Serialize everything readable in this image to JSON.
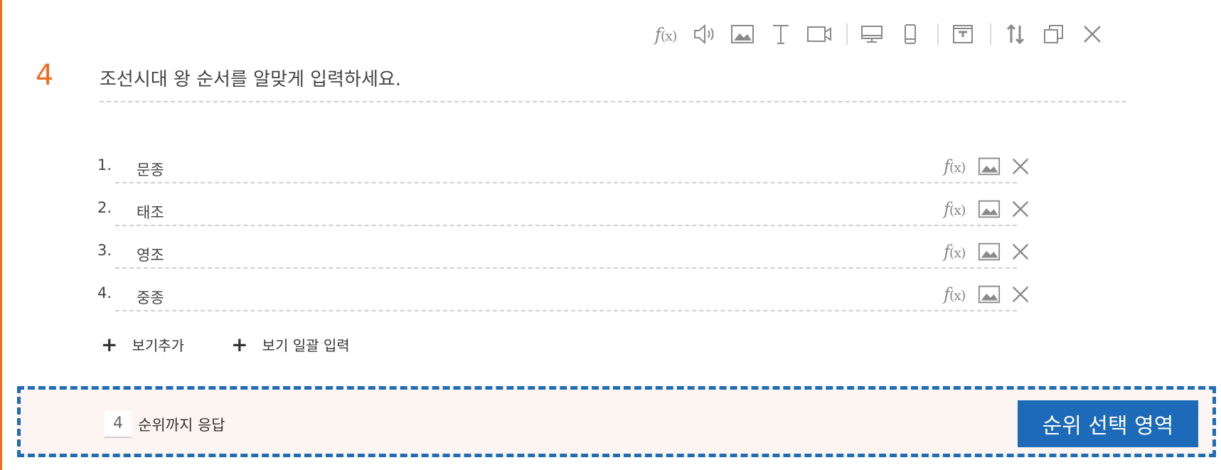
{
  "toolbar": {
    "fx_label": "f",
    "fx_paren": "(x)"
  },
  "question": {
    "number": "4",
    "title": "조선시대 왕 순서를 알맞게 입력하세요."
  },
  "options": [
    {
      "index": "1.",
      "text": "문종"
    },
    {
      "index": "2.",
      "text": "태조"
    },
    {
      "index": "3.",
      "text": "영조"
    },
    {
      "index": "4.",
      "text": "중종"
    }
  ],
  "add": {
    "add_option": "보기추가",
    "bulk_input": "보기 일괄 입력",
    "plus": "+"
  },
  "rank": {
    "value": "4",
    "label": "순위까지 응답",
    "badge": "순위 선택 영역"
  },
  "colors": {
    "accent": "#f26b21",
    "highlight_border": "#1f6db5",
    "badge_bg": "#1c6ab8",
    "section_bg": "#fdf5f1"
  }
}
